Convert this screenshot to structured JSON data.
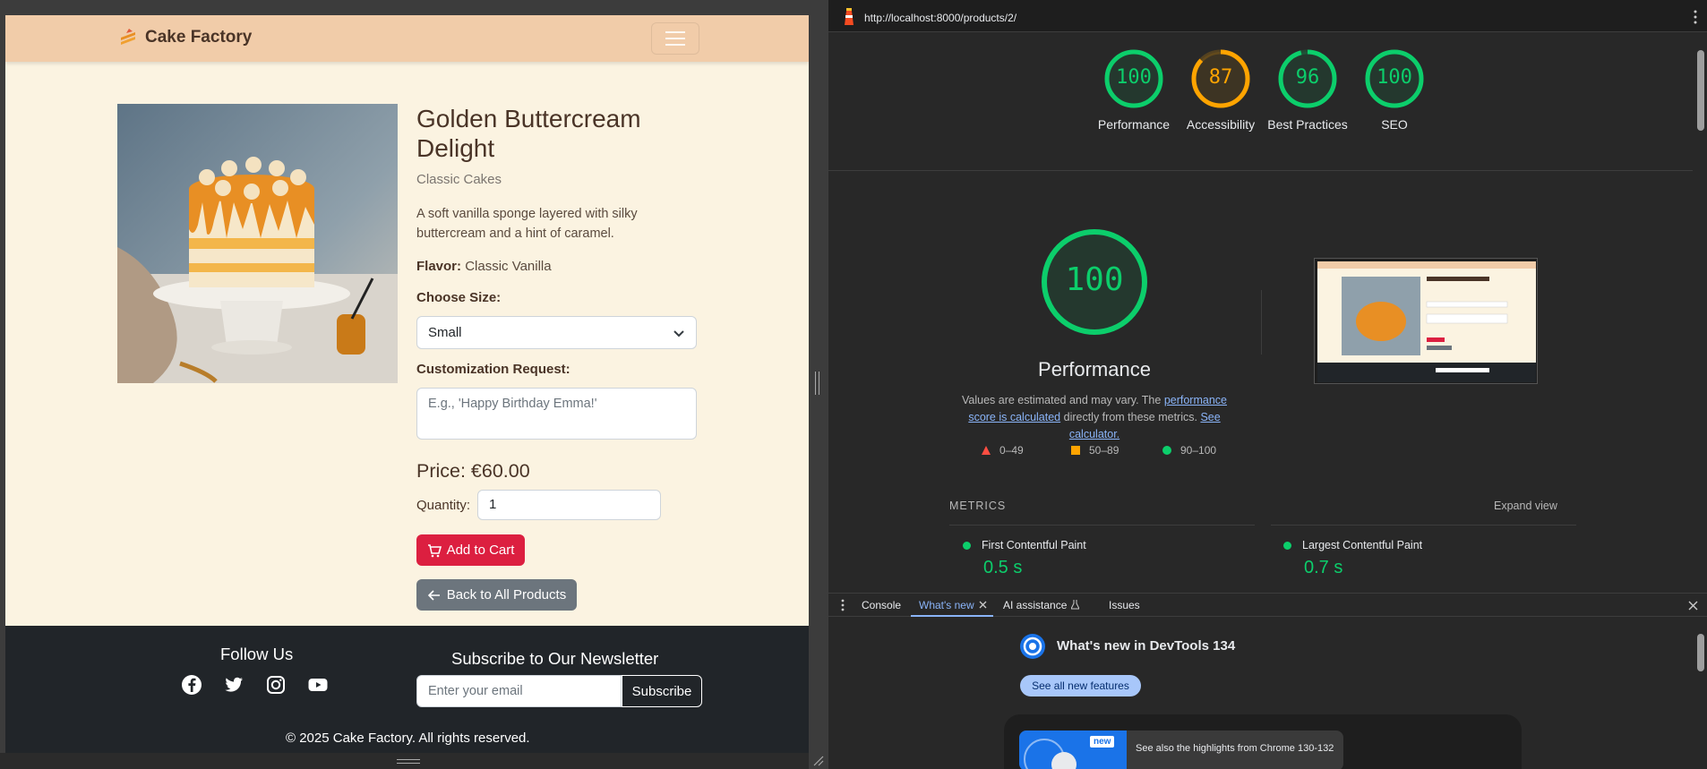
{
  "site": {
    "brand": "Cake Factory",
    "product": {
      "title": "Golden Buttercream Delight",
      "category": "Classic Cakes",
      "description": "A soft vanilla sponge layered with silky buttercream and a hint of caramel.",
      "flavor_label": "Flavor:",
      "flavor_value": "Classic Vanilla",
      "size_label": "Choose Size:",
      "size_value": "Small",
      "custom_label": "Customization Request:",
      "custom_placeholder": "E.g., 'Happy Birthday Emma!'",
      "price": "Price: €60.00",
      "quantity_label": "Quantity:",
      "quantity_value": "1",
      "add_to_cart": "Add to Cart",
      "back": "Back to All Products"
    },
    "footer": {
      "follow_title": "Follow Us",
      "socials": [
        "facebook-icon",
        "twitter-icon",
        "instagram-icon",
        "youtube-icon"
      ],
      "newsletter_title": "Subscribe to Our Newsletter",
      "email_placeholder": "Enter your email",
      "subscribe": "Subscribe",
      "copyright": "© 2025 Cake Factory. All rights reserved."
    }
  },
  "devtools": {
    "url": "http://localhost:8000/products/2/",
    "scores": [
      {
        "value": "100",
        "label": "Performance",
        "color": "#0cce6b",
        "fraction": 1.0
      },
      {
        "value": "87",
        "label": "Accessibility",
        "color": "#ffa400",
        "fraction": 0.87
      },
      {
        "value": "96",
        "label": "Best Practices",
        "color": "#0cce6b",
        "fraction": 0.96
      },
      {
        "value": "100",
        "label": "SEO",
        "color": "#0cce6b",
        "fraction": 1.0
      }
    ],
    "performance": {
      "score": "100",
      "title": "Performance",
      "note_pre": "Values are estimated and may vary. The ",
      "note_link1": "performance score is calculated",
      "note_mid": " directly from these metrics. ",
      "note_link2": "See calculator."
    },
    "legend": [
      "0–49",
      "50–89",
      "90–100"
    ],
    "metrics_header": "METRICS",
    "expand_view": "Expand view",
    "metrics": [
      {
        "name": "First Contentful Paint",
        "value": "0.5 s"
      },
      {
        "name": "Largest Contentful Paint",
        "value": "0.7 s"
      }
    ],
    "drawer_tabs": [
      "Console",
      "What's new",
      "AI assistance",
      "Issues"
    ],
    "whats_new": {
      "title": "What's new in DevTools 134",
      "button": "See all new features",
      "badge": "new",
      "highlight": "See also the highlights from Chrome 130-132"
    }
  },
  "colors": {
    "pass": "#0cce6b",
    "average": "#ffa400",
    "fail": "#ff4e42",
    "accent": "#dc1f40"
  }
}
